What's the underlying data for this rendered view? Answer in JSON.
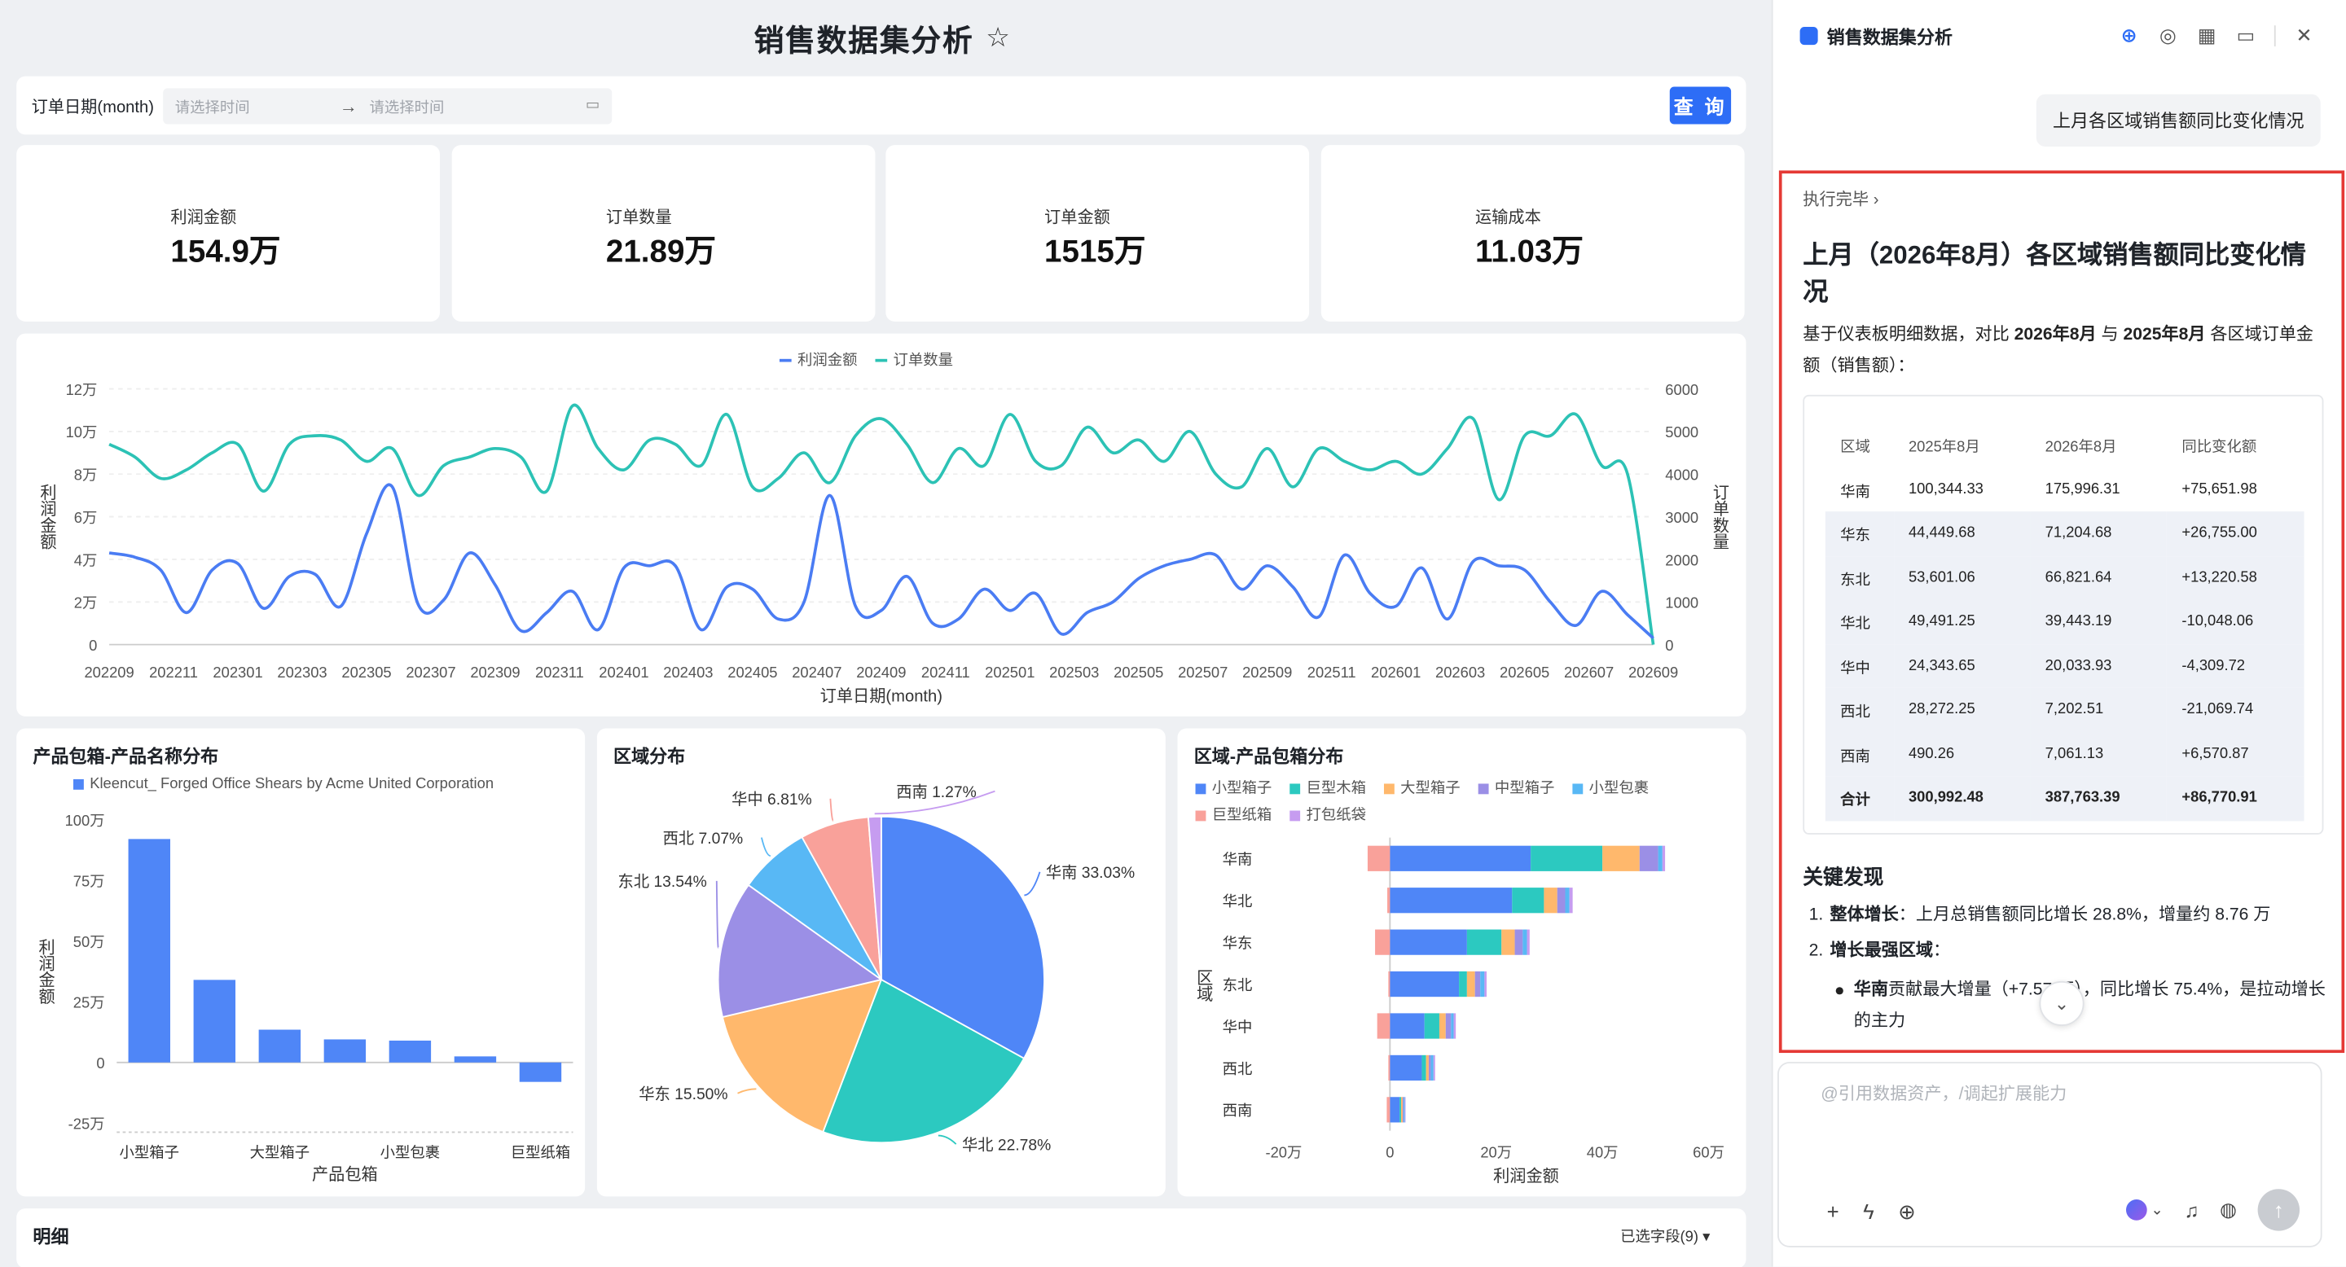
{
  "dashboard": {
    "title": "销售数据集分析",
    "filter": {
      "label": "订单日期(month)",
      "start_placeholder": "请选择时间",
      "end_placeholder": "请选择时间",
      "query_label": "查 询"
    },
    "kpis": [
      {
        "label": "利润金额",
        "value": "154.9万"
      },
      {
        "label": "订单数量",
        "value": "21.89万"
      },
      {
        "label": "订单金额",
        "value": "1515万"
      },
      {
        "label": "运输成本",
        "value": "11.03万"
      }
    ],
    "detail": {
      "title": "明细",
      "selected_fields": "已选字段(9)"
    }
  },
  "chart_data": [
    {
      "type": "line",
      "legend": [
        "利润金额",
        "订单数量"
      ],
      "xlabel": "订单日期(month)",
      "ylabel": "利润金额",
      "y2label": "订单数量",
      "x_ticks": [
        "202209",
        "202211",
        "202301",
        "202303",
        "202305",
        "202307",
        "202309",
        "202311",
        "202401",
        "202403",
        "202405",
        "202407",
        "202409",
        "202411",
        "202501",
        "202503",
        "202505",
        "202507",
        "202509",
        "202511",
        "202601",
        "202603",
        "202605",
        "202607",
        "202609"
      ],
      "y_ticks": [
        "12万",
        "10万",
        "8万",
        "6万",
        "4万",
        "2万",
        "0"
      ],
      "y2_ticks": [
        "6000",
        "5000",
        "4000",
        "3000",
        "2000",
        "1000",
        "0"
      ],
      "ylim": [
        0,
        120000
      ],
      "y2lim": [
        0,
        6000
      ],
      "colors": [
        "#4a7cf3",
        "#2cc2b5"
      ],
      "series": [
        {
          "name": "利润金额",
          "values": [
            43000,
            41000,
            35000,
            15000,
            35000,
            38000,
            17000,
            32000,
            33000,
            18000,
            52000,
            74000,
            19000,
            21000,
            43000,
            28000,
            6500,
            15000,
            25000,
            7000,
            36000,
            37000,
            37000,
            7000,
            27000,
            26000,
            12000,
            20000,
            70000,
            18000,
            16000,
            32000,
            10000,
            12000,
            26000,
            16000,
            24000,
            5000,
            15000,
            20000,
            31000,
            37000,
            40000,
            42000,
            26000,
            37000,
            27000,
            13000,
            42000,
            24000,
            18000,
            36000,
            12000,
            39000,
            37000,
            35000,
            20000,
            9000,
            25000,
            14000,
            3000
          ]
        },
        {
          "name": "订单数量",
          "values": [
            4700,
            4400,
            3900,
            4100,
            4500,
            4700,
            3600,
            4700,
            4900,
            4800,
            4300,
            4600,
            3500,
            4200,
            4400,
            4600,
            4400,
            3600,
            5600,
            4600,
            4100,
            4800,
            4700,
            4200,
            5400,
            3700,
            3900,
            4500,
            3800,
            4900,
            5300,
            4700,
            3800,
            4600,
            4200,
            5400,
            4300,
            4200,
            5100,
            4500,
            4800,
            4300,
            5000,
            4000,
            3700,
            4600,
            3700,
            4600,
            4300,
            4100,
            4300,
            4000,
            4600,
            5300,
            3400,
            4900,
            4900,
            5400,
            4200,
            4000,
            0
          ]
        }
      ]
    },
    {
      "type": "bar",
      "title": "产品包箱-产品名称分布",
      "legend": [
        "Kleencut_ Forged Office Shears by Acme United Corporation"
      ],
      "xlabel": "产品包箱",
      "ylabel": "利润金额",
      "categories": [
        "小型箱子",
        "",
        "大型箱子",
        "",
        "小型包裹",
        "",
        "巨型纸箱"
      ],
      "x_tick_labels": [
        "小型箱子",
        "大型箱子",
        "小型包裹",
        "巨型纸箱"
      ],
      "values": [
        920000,
        340000,
        135000,
        95000,
        90000,
        25000,
        -80000
      ],
      "y_ticks": [
        "100万",
        "75万",
        "50万",
        "25万",
        "0",
        "-25万"
      ],
      "ylim": [
        -250000,
        1000000
      ],
      "color": "#4f86f7"
    },
    {
      "type": "pie",
      "title": "区域分布",
      "labels": [
        "华南",
        "华北",
        "华东",
        "东北",
        "西北",
        "华中",
        "西南"
      ],
      "values": [
        33.03,
        22.78,
        15.5,
        13.54,
        7.07,
        6.81,
        1.27
      ],
      "display_labels": [
        "华南 33.03%",
        "华北 22.78%",
        "华东 15.50%",
        "东北 13.54%",
        "西北 7.07%",
        "华中 6.81%",
        "西南 1.27%"
      ],
      "colors": [
        "#4f86f7",
        "#2cc9c0",
        "#ffb86c",
        "#9b8fe6",
        "#58b8f5",
        "#f9a19a",
        "#c69cf0"
      ]
    },
    {
      "type": "bar",
      "orientation": "horizontal",
      "stacked": true,
      "title": "区域-产品包箱分布",
      "categories": [
        "华南",
        "华北",
        "华东",
        "东北",
        "华中",
        "西北",
        "西南"
      ],
      "xlabel": "利润金额",
      "ylabel": "区域",
      "x_ticks": [
        "-20万",
        "0",
        "20万",
        "40万",
        "60万"
      ],
      "xlim": [
        -200000,
        600000
      ],
      "series": [
        {
          "name": "小型箱子",
          "color": "#4f86f7",
          "values": [
            265000,
            230000,
            145000,
            130000,
            65000,
            60000,
            18000
          ]
        },
        {
          "name": "巨型木箱",
          "color": "#2cc9c0",
          "values": [
            135000,
            60000,
            65000,
            15000,
            28000,
            8000,
            3000
          ]
        },
        {
          "name": "大型箱子",
          "color": "#ffb86c",
          "values": [
            70000,
            25000,
            25000,
            15000,
            12000,
            5000,
            3000
          ]
        },
        {
          "name": "中型箱子",
          "color": "#9b8fe6",
          "values": [
            35000,
            15000,
            15000,
            10000,
            10000,
            4000,
            2000
          ]
        },
        {
          "name": "小型包裹",
          "color": "#58b8f5",
          "values": [
            8000,
            8000,
            8000,
            8000,
            5000,
            5000,
            2000
          ]
        },
        {
          "name": "巨型纸箱",
          "color": "#f9a19a",
          "values": [
            -42000,
            -5000,
            -28000,
            -3000,
            -24000,
            -3000,
            -6000
          ]
        },
        {
          "name": "打包纸袋",
          "color": "#c69cf0",
          "values": [
            5000,
            6000,
            5000,
            4000,
            4000,
            3000,
            1000
          ]
        }
      ]
    }
  ],
  "assistant": {
    "header_title": "销售数据集分析",
    "user_message": "上月各区域销售额同比变化情况",
    "status": "执行完毕",
    "answer_title": "上月（2026年8月）各区域销售额同比变化情况",
    "desc_plain1": "基于仪表板明细数据，对比 ",
    "desc_bold1": "2026年8月",
    "desc_plain2": " 与 ",
    "desc_bold2": "2025年8月",
    "desc_plain3": " 各区域订单金额（销售额）：",
    "table": {
      "headers": [
        "区域",
        "2025年8月",
        "2026年8月",
        "同比变化额"
      ],
      "rows": [
        [
          "华南",
          "100,344.33",
          "175,996.31",
          "+75,651.98"
        ],
        [
          "华东",
          "44,449.68",
          "71,204.68",
          "+26,755.00"
        ],
        [
          "东北",
          "53,601.06",
          "66,821.64",
          "+13,220.58"
        ],
        [
          "华北",
          "49,491.25",
          "39,443.19",
          "-10,048.06"
        ],
        [
          "华中",
          "24,343.65",
          "20,033.93",
          "-4,309.72"
        ],
        [
          "西北",
          "28,272.25",
          "7,202.51",
          "-21,069.74"
        ],
        [
          "西南",
          "490.26",
          "7,061.13",
          "+6,570.87"
        ],
        [
          "合计",
          "300,992.48",
          "387,763.39",
          "+86,770.91"
        ]
      ]
    },
    "findings_title": "关键发现",
    "finding1_label": "整体增长",
    "finding1_text": "：上月总销售额同比增长 28.8%，增量约 8.76 万",
    "finding2_label": "增长最强区域",
    "finding2_text": "：",
    "finding2_sub_bold": "华南",
    "finding2_sub_text": "贡献最大增量（+7.57 万），同比增长 75.4%，是拉动增长的主力",
    "input_placeholder": "@引用数据资产，/调起扩展能力"
  }
}
